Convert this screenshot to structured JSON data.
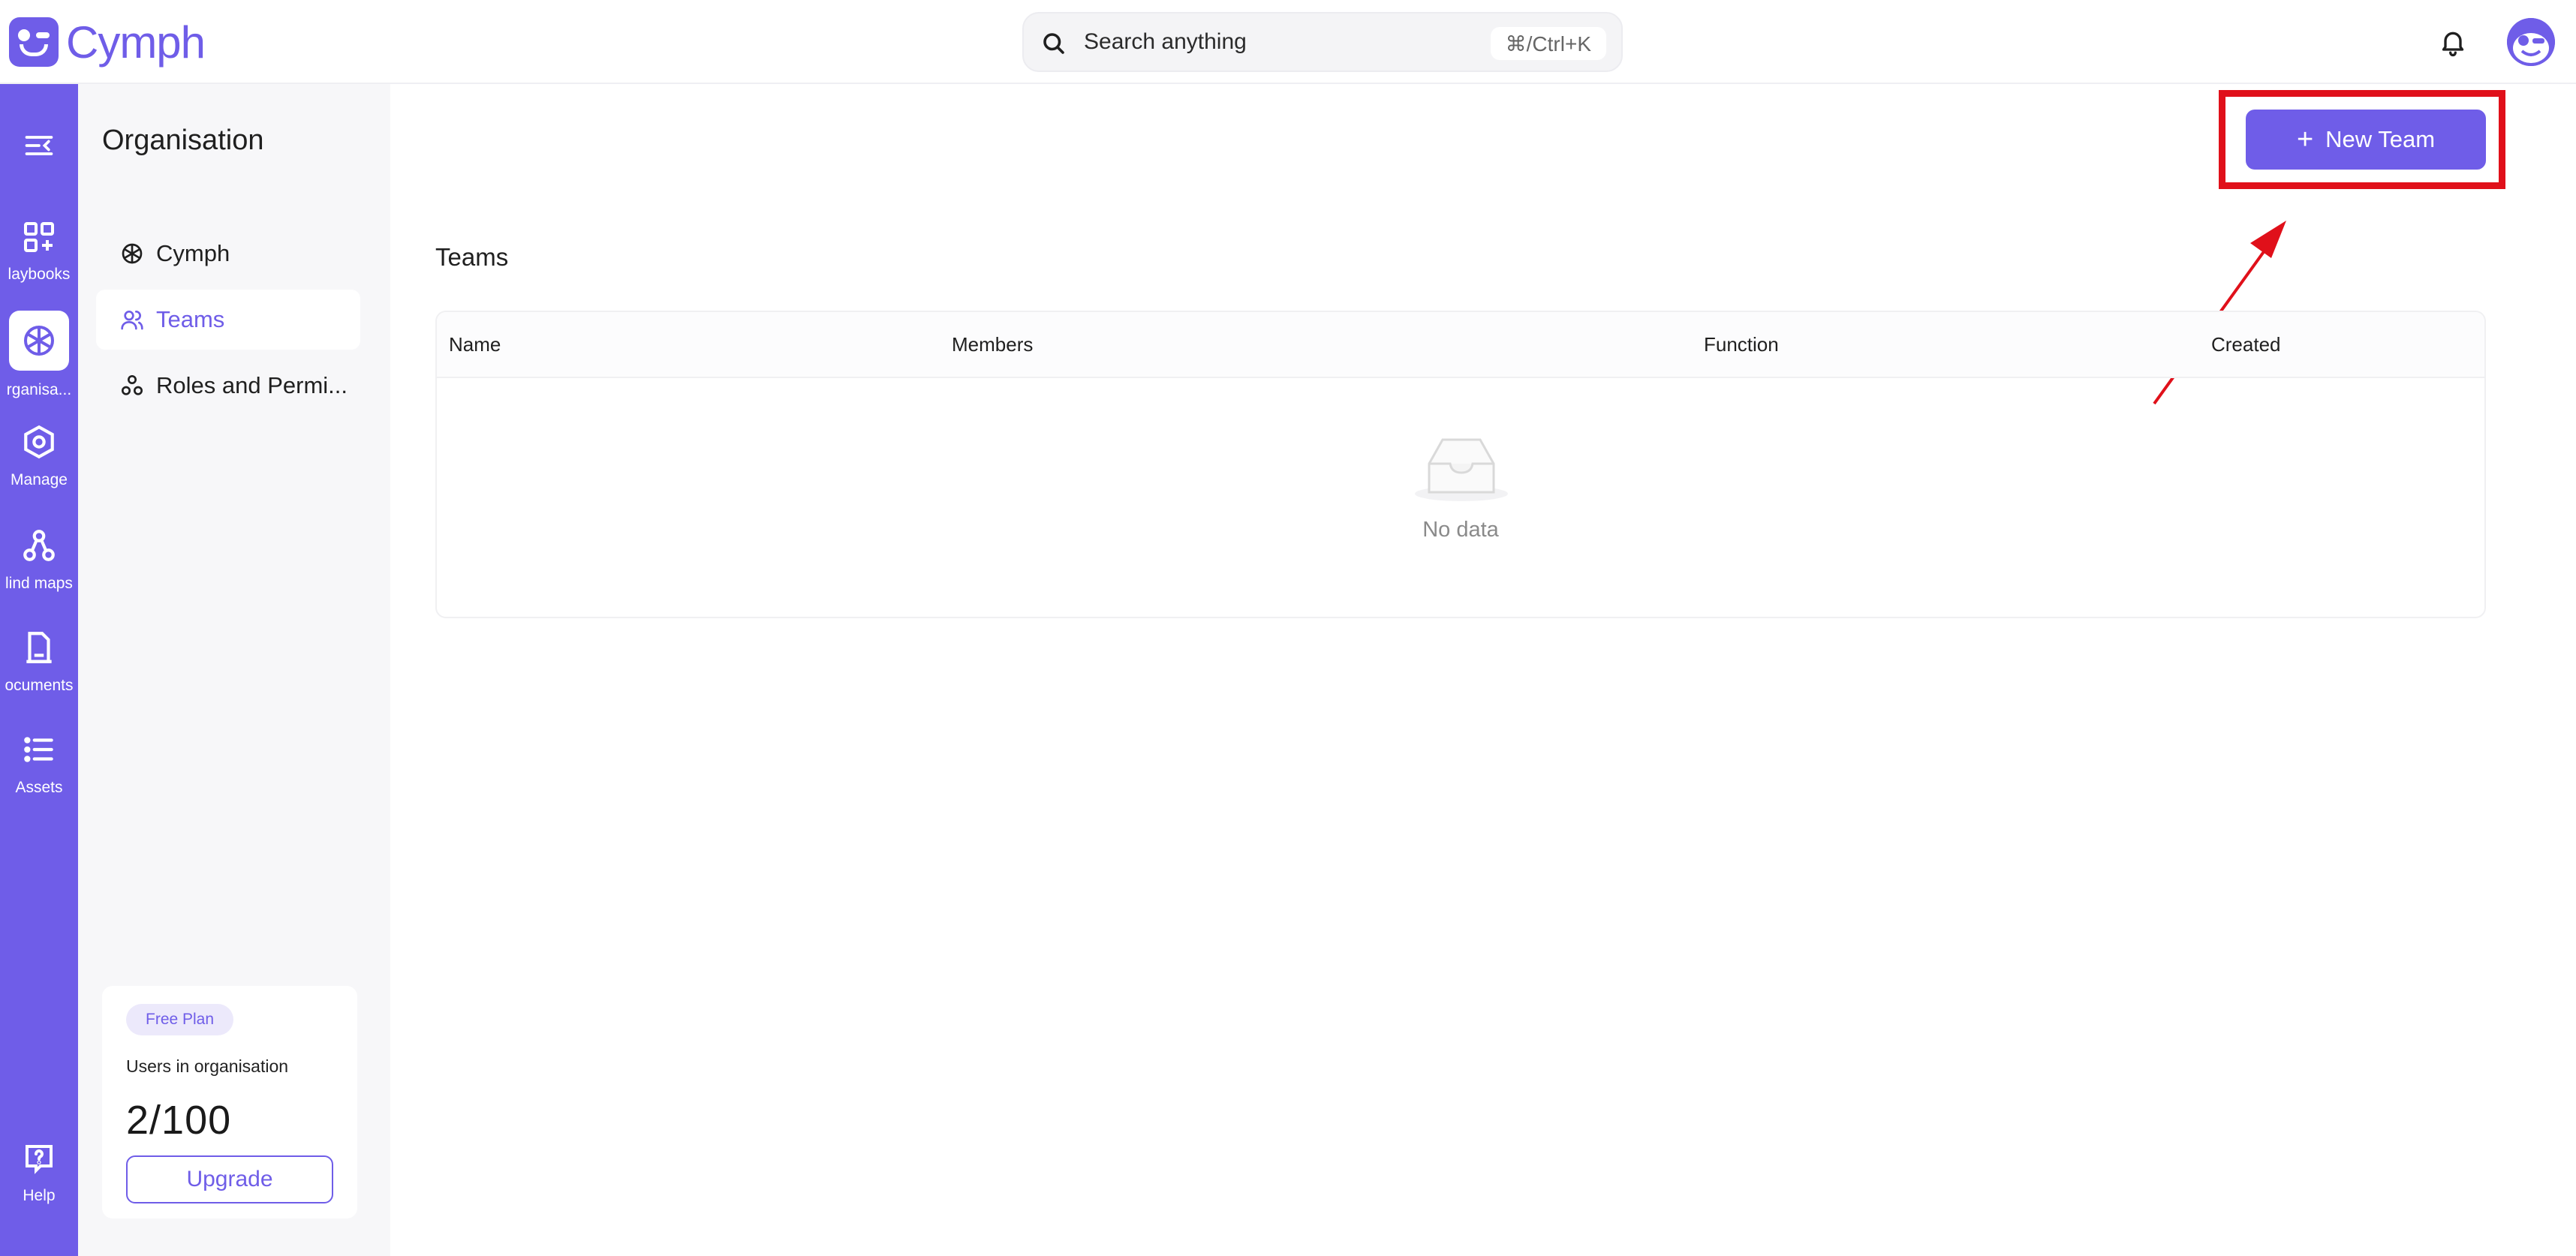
{
  "app": {
    "brand": "Cymph",
    "accent": "#6f5de8",
    "highlight": "#e0101a"
  },
  "search": {
    "placeholder": "Search anything",
    "shortcut": "⌘/Ctrl+K"
  },
  "rail": {
    "items": [
      {
        "label": "Playbooks",
        "visible_label": "laybooks"
      },
      {
        "label": "Organisa...",
        "visible_label": "rganisa..."
      },
      {
        "label": "Manage"
      },
      {
        "label": "Mind maps",
        "visible_label": "lind maps"
      },
      {
        "label": "Documents",
        "visible_label": "ocuments"
      },
      {
        "label": "Assets"
      }
    ],
    "help_label": "Help"
  },
  "sidebar": {
    "title": "Organisation",
    "items": [
      {
        "label": "Cymph",
        "icon": "cube-icon"
      },
      {
        "label": "Teams",
        "icon": "users-icon",
        "active": true
      },
      {
        "label": "Roles and Permi...",
        "icon": "roles-icon"
      }
    ],
    "plan": {
      "badge": "Free Plan",
      "users_label": "Users in organisation",
      "users_count": "2/100",
      "upgrade_label": "Upgrade"
    }
  },
  "main": {
    "new_team_label": "New Team",
    "section_title": "Teams",
    "table": {
      "columns": [
        "Name",
        "Members",
        "Function",
        "Created"
      ],
      "rows": [],
      "empty_text": "No data"
    }
  }
}
